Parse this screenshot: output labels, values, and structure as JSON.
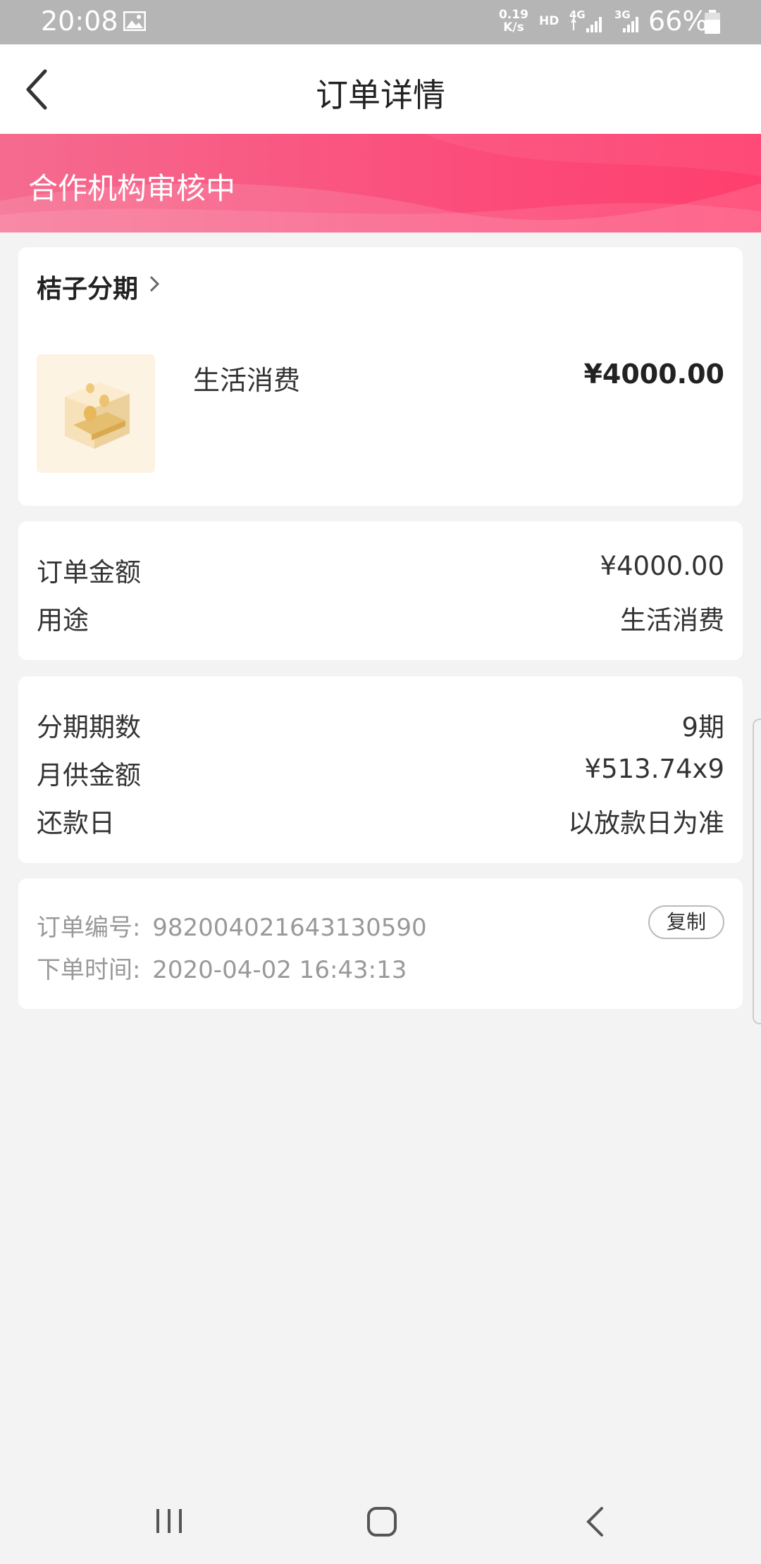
{
  "status_bar": {
    "time": "20:08",
    "speed_value": "0.19",
    "speed_unit": "K/s",
    "hd": "HD",
    "net1": "4G",
    "net2": "3G",
    "battery": "66%"
  },
  "header": {
    "title": "订单详情"
  },
  "banner": {
    "status": "合作机构审核中",
    "color_start": "#f56b8f",
    "color_end": "#fe3f6e"
  },
  "merchant": {
    "name": "桔子分期"
  },
  "product": {
    "name": "生活消费",
    "price": "¥4000.00"
  },
  "order_info": {
    "amount_label": "订单金额",
    "amount_value": "¥4000.00",
    "purpose_label": "用途",
    "purpose_value": "生活消费"
  },
  "installment": {
    "periods_label": "分期期数",
    "periods_value": "9期",
    "monthly_label": "月供金额",
    "monthly_value": "¥513.74x9",
    "repay_label": "还款日",
    "repay_value": "以放款日为准"
  },
  "meta": {
    "order_no_label": "订单编号:",
    "order_no": "982004021643130590",
    "time_label": "下单时间:",
    "time": "2020-04-02 16:43:13",
    "copy_label": "复制"
  }
}
